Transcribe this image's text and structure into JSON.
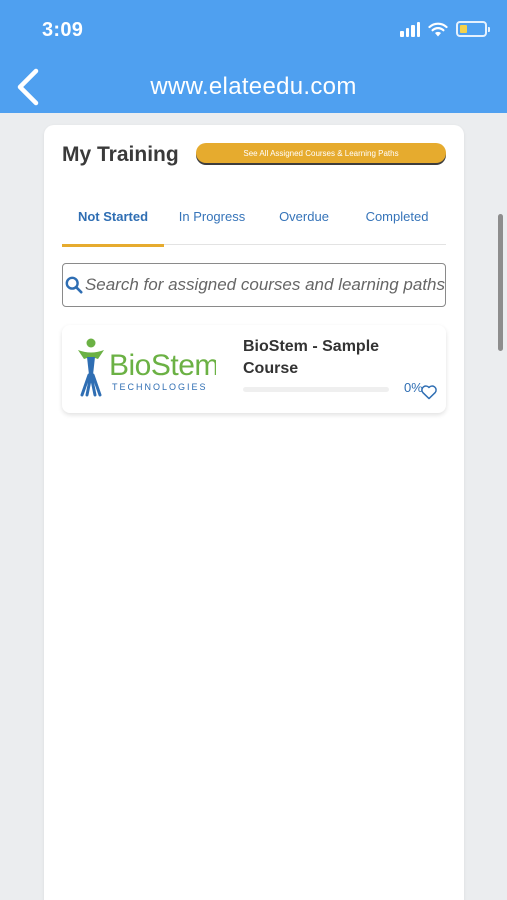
{
  "status_bar": {
    "time": "3:09"
  },
  "nav": {
    "back_icon": "chevron-left-icon",
    "title": "www.elateedu.com"
  },
  "colors": {
    "header_blue": "#4fa0f0",
    "accent_gold": "#e6ab2e",
    "link_blue": "#2f6eb3"
  },
  "training": {
    "title": "My Training",
    "see_all_label": "See All Assigned Courses & Learning Paths",
    "tabs": [
      {
        "label": "Not Started",
        "active": true
      },
      {
        "label": "In Progress",
        "active": false
      },
      {
        "label": "Overdue",
        "active": false
      },
      {
        "label": "Completed",
        "active": false
      }
    ],
    "search": {
      "icon": "search-icon",
      "placeholder": "Search for assigned courses and learning paths"
    },
    "courses": [
      {
        "logo_text": "BioStem",
        "logo_subtext": "TECHNOLOGIES",
        "title": "BioStem - Sample Course",
        "progress_label": "0%",
        "progress": 0,
        "favorite_icon": "heart-outline-icon"
      }
    ]
  }
}
